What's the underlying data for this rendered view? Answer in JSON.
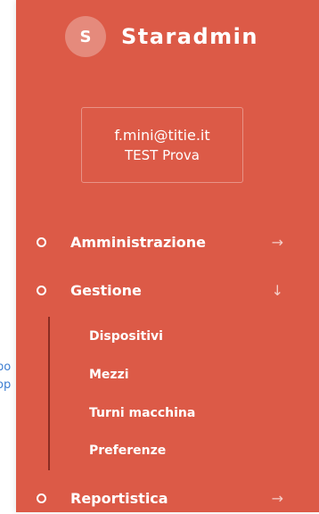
{
  "background": {
    "line1": "po",
    "line2": "op"
  },
  "brand": {
    "logo_letter": "S",
    "name": "Staradmin"
  },
  "user": {
    "email": "f.mini@titie.it",
    "name": "TEST Prova"
  },
  "nav": {
    "amministrazione": {
      "label": "Amministrazione",
      "arrow": "→"
    },
    "gestione": {
      "label": "Gestione",
      "arrow": "↓"
    },
    "reportistica": {
      "label": "Reportistica",
      "arrow": "→"
    }
  },
  "submenu": {
    "dispositivi": "Dispositivi",
    "mezzi": "Mezzi",
    "turni": "Turni macchina",
    "preferenze": "Preferenze"
  },
  "colors": {
    "sidebar": "#dc5a47",
    "logo_bg": "#e58a7c",
    "submenu_line": "#8a2c22",
    "link": "#3f7fd1"
  }
}
